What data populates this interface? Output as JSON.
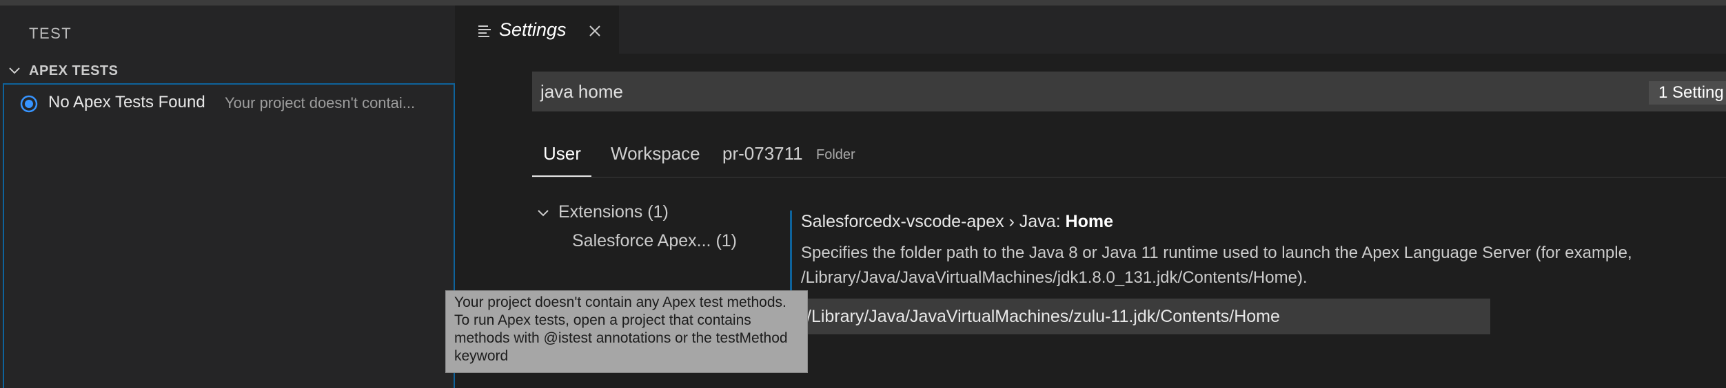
{
  "sidebar": {
    "title": "TEST",
    "section_label": "APEX TESTS",
    "tree_item": {
      "name": "No Apex Tests Found",
      "description": "Your project doesn't contai..."
    }
  },
  "editor": {
    "tab_label": "Settings",
    "search": {
      "value": "java home",
      "result_count": "1 Setting"
    },
    "scopes": {
      "user": "User",
      "workspace": "Workspace",
      "folder_name": "pr-073711",
      "folder_hint": "Folder"
    },
    "toc": {
      "group_label": "Extensions (1)",
      "item_label": "Salesforce Apex... (1)"
    },
    "setting": {
      "title_prefix": "Salesforcedx-vscode-apex › Java: ",
      "title_name": "Home",
      "description": "Specifies the folder path to the Java 8 or Java 11 runtime used to launch the Apex Language Server (for example, /Library/Java/JavaVirtualMachines/jdk1.8.0_131.jdk/Contents/Home).",
      "value": "/Library/Java/JavaVirtualMachines/zulu-11.jdk/Contents/Home"
    }
  },
  "tooltip": {
    "text": "Your project doesn't contain any Apex test methods. To run Apex tests, open a project that contains methods with @istest annotations or the testMethod keyword"
  },
  "icons": {
    "section_chevron": "chevron-down-icon",
    "tree_status": "radio-icon",
    "tab_icon": "settings-list-icon",
    "tab_close": "close-icon",
    "toc_chevron": "chevron-down-icon"
  },
  "colors": {
    "accent": "#0e639c",
    "radio": "#3794ff",
    "tooltip_bg": "#a6a6a6"
  }
}
